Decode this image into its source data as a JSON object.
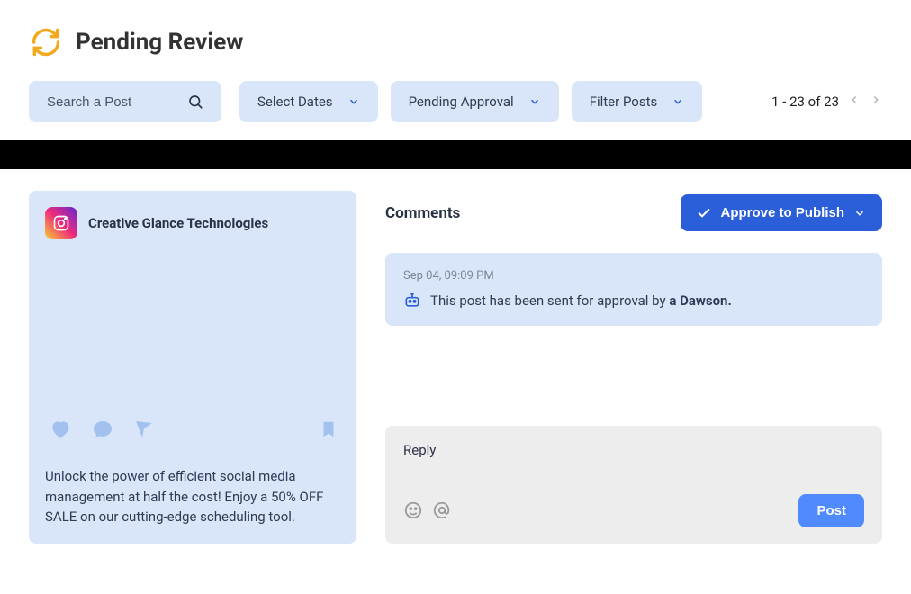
{
  "page": {
    "title": "Pending Review"
  },
  "toolbar": {
    "search_placeholder": "Search a Post",
    "select_dates": "Select Dates",
    "status_filter": "Pending Approval",
    "filter_posts": "Filter Posts"
  },
  "pagination": {
    "text": "1 - 23 of 23"
  },
  "post": {
    "author": "Creative Glance Technologies",
    "caption": "Unlock the power of efficient social media management at half the cost!  Enjoy a 50% OFF SALE on our cutting-edge scheduling tool."
  },
  "comments": {
    "title": "Comments",
    "approve_label": "Approve to Publish"
  },
  "activity": {
    "time": "Sep 04, 09:09 PM",
    "message_prefix": "This post has been sent for approval by ",
    "message_actor": "a Dawson."
  },
  "reply": {
    "label": "Reply",
    "post_button": "Post"
  }
}
